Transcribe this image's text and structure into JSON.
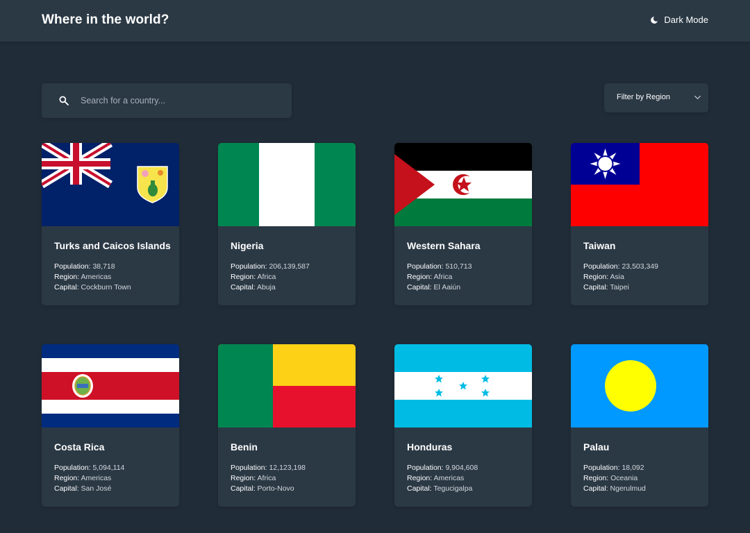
{
  "header": {
    "title": "Where in the world?",
    "theme_label": "Dark Mode",
    "theme_icon": "moon-icon"
  },
  "search": {
    "placeholder": "Search for a country...",
    "icon": "search-icon"
  },
  "filter": {
    "label": "Filter by Region",
    "icon": "chevron-down-icon"
  },
  "labels": {
    "population": "Population:",
    "region": "Region:",
    "capital": "Capital:"
  },
  "countries": [
    {
      "name": "Turks and Caicos Islands",
      "population": "38,718",
      "region": "Americas",
      "capital": "Cockburn Town",
      "flag": "turks-and-caicos-flag"
    },
    {
      "name": "Nigeria",
      "population": "206,139,587",
      "region": "Africa",
      "capital": "Abuja",
      "flag": "nigeria-flag"
    },
    {
      "name": "Western Sahara",
      "population": "510,713",
      "region": "Africa",
      "capital": "El Aaiún",
      "flag": "western-sahara-flag"
    },
    {
      "name": "Taiwan",
      "population": "23,503,349",
      "region": "Asia",
      "capital": "Taipei",
      "flag": "taiwan-flag"
    },
    {
      "name": "Costa Rica",
      "population": "5,094,114",
      "region": "Americas",
      "capital": "San José",
      "flag": "costa-rica-flag"
    },
    {
      "name": "Benin",
      "population": "12,123,198",
      "region": "Africa",
      "capital": "Porto-Novo",
      "flag": "benin-flag"
    },
    {
      "name": "Honduras",
      "population": "9,904,608",
      "region": "Americas",
      "capital": "Tegucigalpa",
      "flag": "honduras-flag"
    },
    {
      "name": "Palau",
      "population": "18,092",
      "region": "Oceania",
      "capital": "Ngerulmud",
      "flag": "palau-flag"
    }
  ],
  "colors": {
    "background": "#202c37",
    "element": "#2b3945",
    "text": "#ffffff"
  }
}
